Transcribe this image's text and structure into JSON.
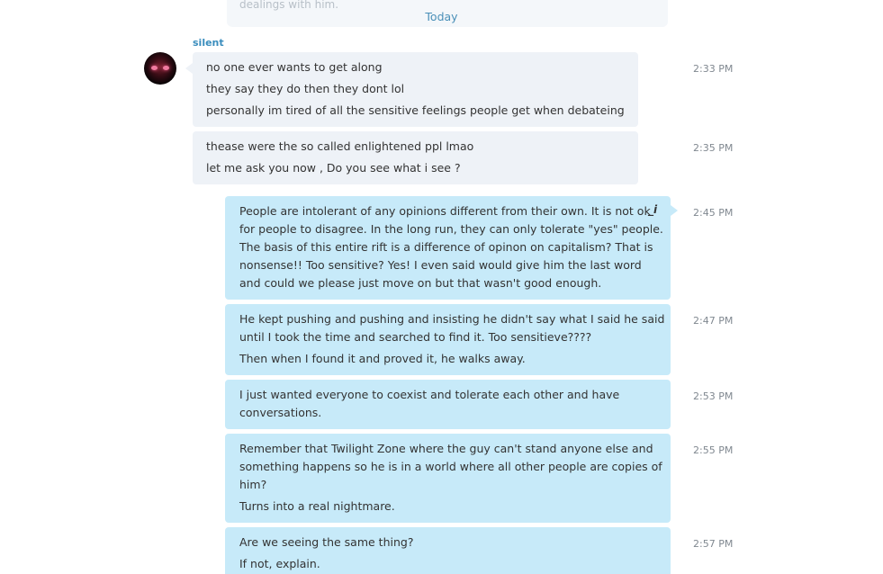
{
  "previous_message_fragment": "dealings with him.",
  "date_separator": "Today",
  "sender_name": "silent",
  "edit_icon_glyph": "_i",
  "messages": [
    {
      "lines": [
        "no one ever wants to get along",
        "they say they do then they dont lol",
        "personally im tired of all the sensitive feelings people  get when debateing"
      ],
      "time": "2:33 PM"
    },
    {
      "lines": [
        "thease were the so called enlightened ppl lmao",
        "let me ask you now , Do you see what i see ?"
      ],
      "time": "2:35 PM"
    },
    {
      "lines": [
        "People are intolerant of any opinions different from their own.   It is not ok",
        "for people to disagree.  In the long run, they can only tolerate \"yes\" people.",
        "The basis of this entire rift is a difference of opinon on capitalism?  That is",
        "nonsense!! Too sensitive?  Yes!  I even said would give him the last word",
        "and could we please just move on but that wasn't good enough."
      ],
      "time": "2:45 PM"
    },
    {
      "lines": [
        "He kept pushing and pushing and insisting he didn't say what I said he said",
        "until I took the time and searched to find it.  Too sensitieve????",
        "Then when I found it and proved it, he walks away."
      ],
      "time": "2:47 PM"
    },
    {
      "lines": [
        "I just wanted everyone to coexist and tolerate each other and have",
        "conversations."
      ],
      "time": "2:53 PM"
    },
    {
      "lines": [
        "Remember that Twilight Zone where the guy can't stand anyone else and",
        "something happens so he is in a world where all other people are copies of",
        "him?",
        "Turns into a real nightmare."
      ],
      "time": "2:55 PM"
    },
    {
      "lines": [
        "Are we seeing the same thing?",
        "If not, explain."
      ],
      "time": "2:57 PM"
    }
  ]
}
